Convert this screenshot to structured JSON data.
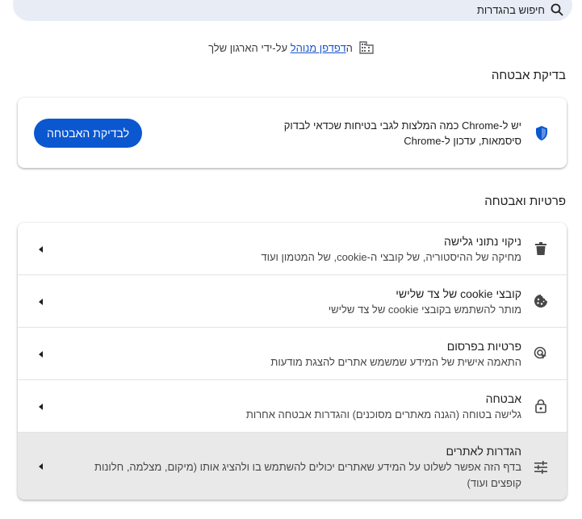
{
  "search": {
    "placeholder": "חיפוש בהגדרות",
    "icon": "search-icon"
  },
  "managed": {
    "prefix": "ה",
    "link": "דפדפן מנוהל",
    "suffix": " על-ידי הארגון שלך",
    "icon": "building-icon"
  },
  "safety_check": {
    "title": "בדיקת אבטחה",
    "line1": "יש ל-Chrome כמה המלצות לגבי בטיחות שכדאי לבדוק",
    "line2": "סיסמאות, עדכון ל-Chrome",
    "button_label": "לבדיקת האבטחה",
    "icon": "shield-check-icon"
  },
  "privacy": {
    "title": "פרטיות ואבטחה",
    "items": [
      {
        "icon": "trash-icon",
        "title": "ניקוי נתוני גלישה",
        "subtitle": "מחיקה של ההיסטוריה, של קובצי ה-cookie, של המטמון ועוד"
      },
      {
        "icon": "cookie-icon",
        "title": "קובצי cookie של צד שלישי",
        "subtitle": "מותר להשתמש בקובצי cookie של צד שלישי"
      },
      {
        "icon": "ad-privacy-icon",
        "title": "פרטיות בפרסום",
        "subtitle": "התאמה אישית של המידע שמשמש אתרים להצגת מודעות"
      },
      {
        "icon": "lock-icon",
        "title": "אבטחה",
        "subtitle": "גלישה בטוחה (הגנה מאתרים מסוכנים) והגדרות אבטחה אחרות"
      },
      {
        "icon": "tune-icon",
        "title": "הגדרות לאתרים",
        "subtitle": "בדף הזה אפשר לשלוט על המידע שאתרים יכולים להשתמש בו ולהציג אותו (מיקום, מצלמה, חלונות קופצים ועוד)"
      }
    ]
  },
  "colors": {
    "accent": "#0b57d0",
    "search_bg": "#e8ecf5",
    "link": "#1a56c9",
    "hover_row": "#e9e9e9"
  }
}
